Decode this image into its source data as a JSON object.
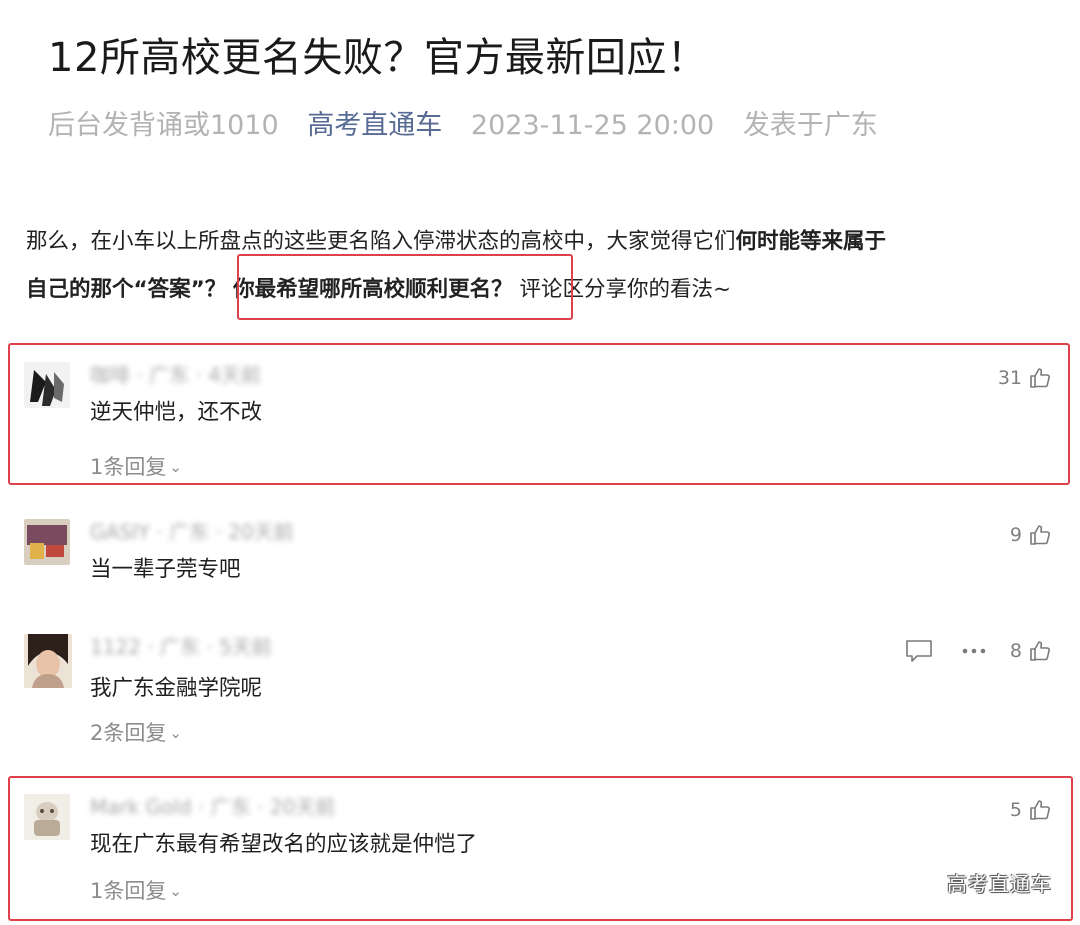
{
  "article": {
    "title": "12所高校更名失败？官方最新回应！",
    "meta": {
      "tag": "后台发背诵或1010",
      "account": "高考直通车",
      "datetime": "2023-11-25 20:00",
      "location": "发表于广东"
    },
    "intro": {
      "p1_plain": "那么，在小车以上所盘点的这些更名陷入停滞状态的高校中，大家觉得它们",
      "p1_bold": "何时能等来属于",
      "p2_bold_a": "自己的那个“答案”？",
      "p2_bold_highlight": "你最希望哪所高校顺利更名？",
      "p2_plain": "评论区分享你的看法~"
    }
  },
  "comments": [
    {
      "author": "咖啡 · 广东 · 4天前",
      "text": "逆天仲恺，还不改",
      "likes": "31",
      "replies": "1条回复"
    },
    {
      "author": "GASIY · 广东 · 20天前",
      "text": "当一辈子莞专吧",
      "likes": "9",
      "replies": ""
    },
    {
      "author": "1122 · 广东 · 5天前",
      "text": "我广东金融学院呢",
      "likes": "8",
      "replies": "2条回复"
    },
    {
      "author": "Mark Gold · 广东 · 20天前",
      "text": "现在广东最有希望改名的应该就是仲恺了",
      "likes": "5",
      "replies": "1条回复"
    }
  ],
  "watermark": "高考直通车",
  "colors": {
    "highlight_border": "#e0404a",
    "account_link": "#576b95"
  },
  "icons": [
    "like-icon",
    "comment-bubble-icon",
    "more-icon",
    "chevron-down-icon"
  ]
}
